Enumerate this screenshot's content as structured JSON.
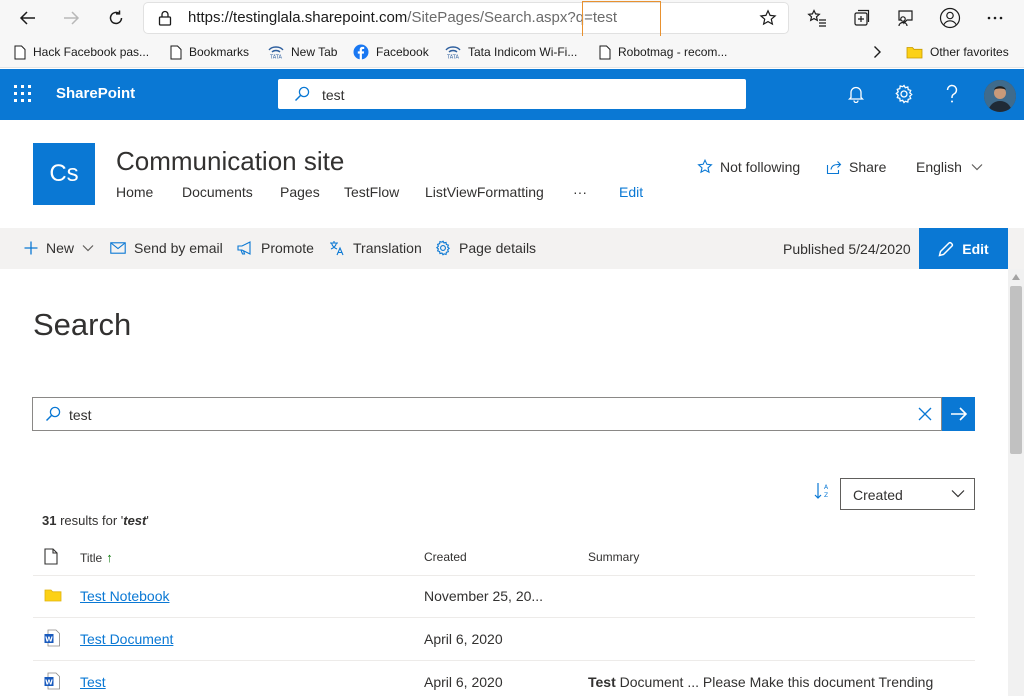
{
  "browser": {
    "url_host": "https://testinglala.sharepoint.com",
    "url_path": "/SitePages/Search.aspx",
    "url_query": "?q=test",
    "bookmarks": [
      {
        "label": "Hack Facebook pas...",
        "icon": "page-icon"
      },
      {
        "label": "Bookmarks",
        "icon": "page-icon"
      },
      {
        "label": "New Tab",
        "icon": "tata-icon"
      },
      {
        "label": "Facebook",
        "icon": "facebook-icon"
      },
      {
        "label": "Tata Indicom Wi-Fi...",
        "icon": "tata-icon"
      },
      {
        "label": "Robotmag - recom...",
        "icon": "page-icon"
      }
    ],
    "other_favorites": "Other favorites"
  },
  "suite": {
    "app_name": "SharePoint",
    "search_value": "test"
  },
  "site": {
    "logo_text": "Cs",
    "title": "Communication site",
    "nav": [
      "Home",
      "Documents",
      "Pages",
      "TestFlow",
      "ListViewFormatting"
    ],
    "nav_more": "···",
    "nav_edit": "Edit",
    "follow": "Not following",
    "share": "Share",
    "language": "English"
  },
  "command_bar": {
    "new": "New",
    "send_email": "Send by email",
    "promote": "Promote",
    "translation": "Translation",
    "page_details": "Page details",
    "published": "Published 5/24/2020",
    "edit": "Edit"
  },
  "search_page": {
    "heading": "Search",
    "query": "test",
    "sort_by": "Created",
    "result_count": "31",
    "result_text": " results for '",
    "result_query": "test",
    "result_end": "'",
    "columns": {
      "title": "Title",
      "title_sort": "↑",
      "created": "Created",
      "summary": "Summary"
    },
    "results": [
      {
        "title": "Test Notebook",
        "created": "November 25, 20...",
        "summary_bold": "",
        "summary": "",
        "icon": "folder-icon"
      },
      {
        "title": "Test Document",
        "created": "April 6, 2020",
        "summary_bold": "",
        "summary": "",
        "icon": "word-doc-icon"
      },
      {
        "title": "Test",
        "created": "April 6, 2020",
        "summary_bold": "Test",
        "summary": " Document ... Please Make this document Trending",
        "icon": "word-doc-icon"
      }
    ]
  },
  "colors": {
    "brand": "#0a78d4",
    "url_highlight": "#e8912f",
    "sort_arrow": "#107c10"
  }
}
